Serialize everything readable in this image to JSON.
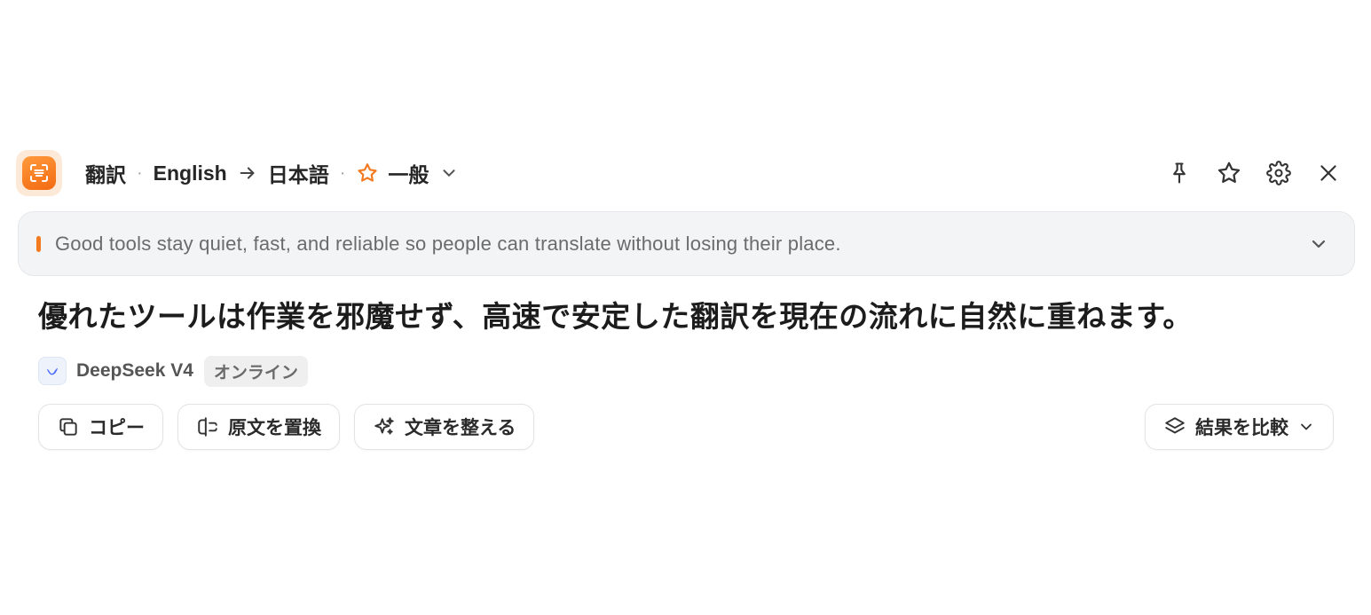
{
  "header": {
    "mode_label": "翻訳",
    "separator": "·",
    "source_lang": "English",
    "target_lang": "日本語",
    "style_label": "一般"
  },
  "source": {
    "text": "Good tools stay quiet, fast, and reliable so people can translate without losing their place."
  },
  "result": {
    "text": "優れたツールは作業を邪魔せず、高速で安定した翻訳を現在の流れに自然に重ねます。"
  },
  "model": {
    "name": "DeepSeek V4",
    "status": "オンライン"
  },
  "actions": {
    "copy_label": "コピー",
    "replace_label": "原文を置換",
    "polish_label": "文章を整える",
    "compare_label": "結果を比較"
  },
  "icons": {
    "app": "translate-scan-icon",
    "arrow": "arrow-right-icon",
    "star": "star-icon",
    "chevron": "chevron-down-icon",
    "pin": "pin-icon",
    "favorite": "star-icon",
    "settings": "gear-icon",
    "close": "close-icon",
    "copy": "copy-icon",
    "replace": "replace-icon",
    "polish": "sparkle-icon",
    "compare": "layers-icon",
    "model": "deepseek-icon"
  },
  "colors": {
    "accent": "#f47a1f",
    "source_bg": "#f3f4f6"
  }
}
